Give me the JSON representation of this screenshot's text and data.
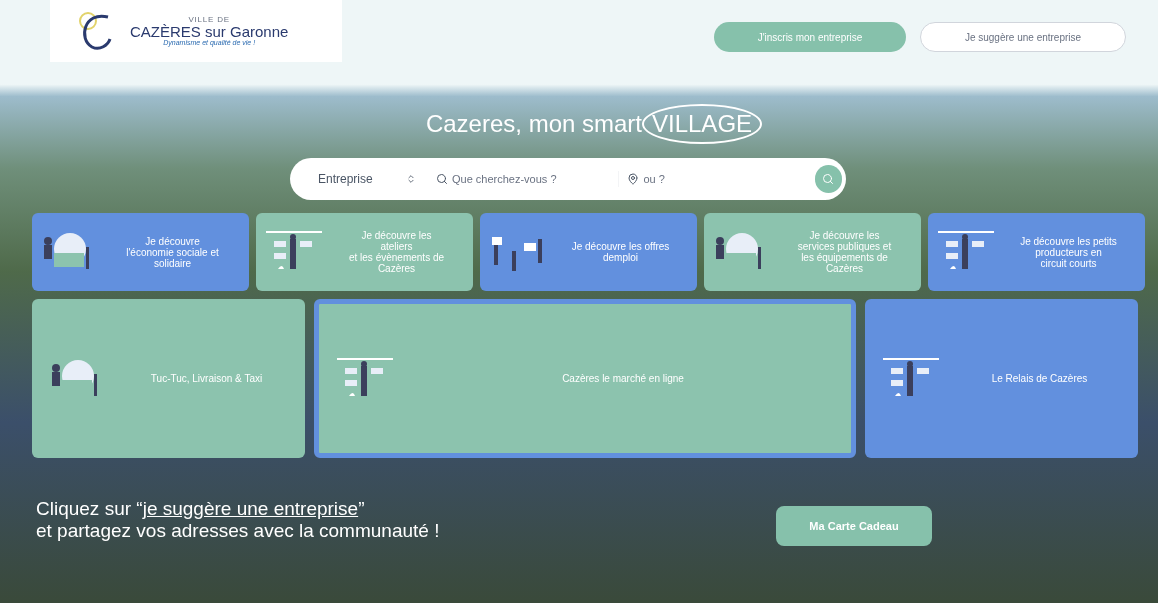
{
  "logo": {
    "small": "VILLE DE",
    "name": "CAZÈRES sur Garonne",
    "tagline": "Dynamisme et qualité de vie !"
  },
  "header_buttons": [
    {
      "label": "J'inscris mon entreprise",
      "kind": "filled"
    },
    {
      "label": "Je suggère une entreprise",
      "kind": "outline"
    }
  ],
  "hero": {
    "title": "Cazeres, mon smart",
    "title_circled": "VILLAGE"
  },
  "search": {
    "category": "Entreprise",
    "what_placeholder": "Que cherchez-vous ?",
    "where_placeholder": "ou ?"
  },
  "tiles": [
    {
      "lines": [
        "Je découvre",
        "l'économie sociale et",
        "solidaire"
      ],
      "color": "#6290de"
    },
    {
      "lines": [
        "Je découvre les",
        "ateliers",
        "et les évènements de",
        "Cazères"
      ],
      "color": "#8cc3ae"
    },
    {
      "lines": [
        "Je découvre les offres",
        "demploi"
      ],
      "color": "#6290de"
    },
    {
      "lines": [
        "Je découvre les",
        "services publiques et",
        "les équipements de",
        "Cazères"
      ],
      "color": "#8cc3ae"
    },
    {
      "lines": [
        "Je découvre les petits",
        "producteurs en",
        "circuit courts"
      ],
      "color": "#6290de"
    }
  ],
  "big_tiles": [
    {
      "label": "Tuc-Tuc, Livraison & Taxi",
      "color": "#8cc3ae",
      "selected": false
    },
    {
      "label": "Cazères le marché en ligne",
      "color": "#8cc3ae",
      "selected": true
    },
    {
      "label": "Le Relais de Cazères",
      "color": "#6290de",
      "selected": false
    }
  ],
  "cta": {
    "before": "Cliquez sur “",
    "link": "je suggère une entreprise",
    "after": "”",
    "line2": "et partagez vos adresses avec la communauté !"
  },
  "gift_button": "Ma Carte Cadeau"
}
